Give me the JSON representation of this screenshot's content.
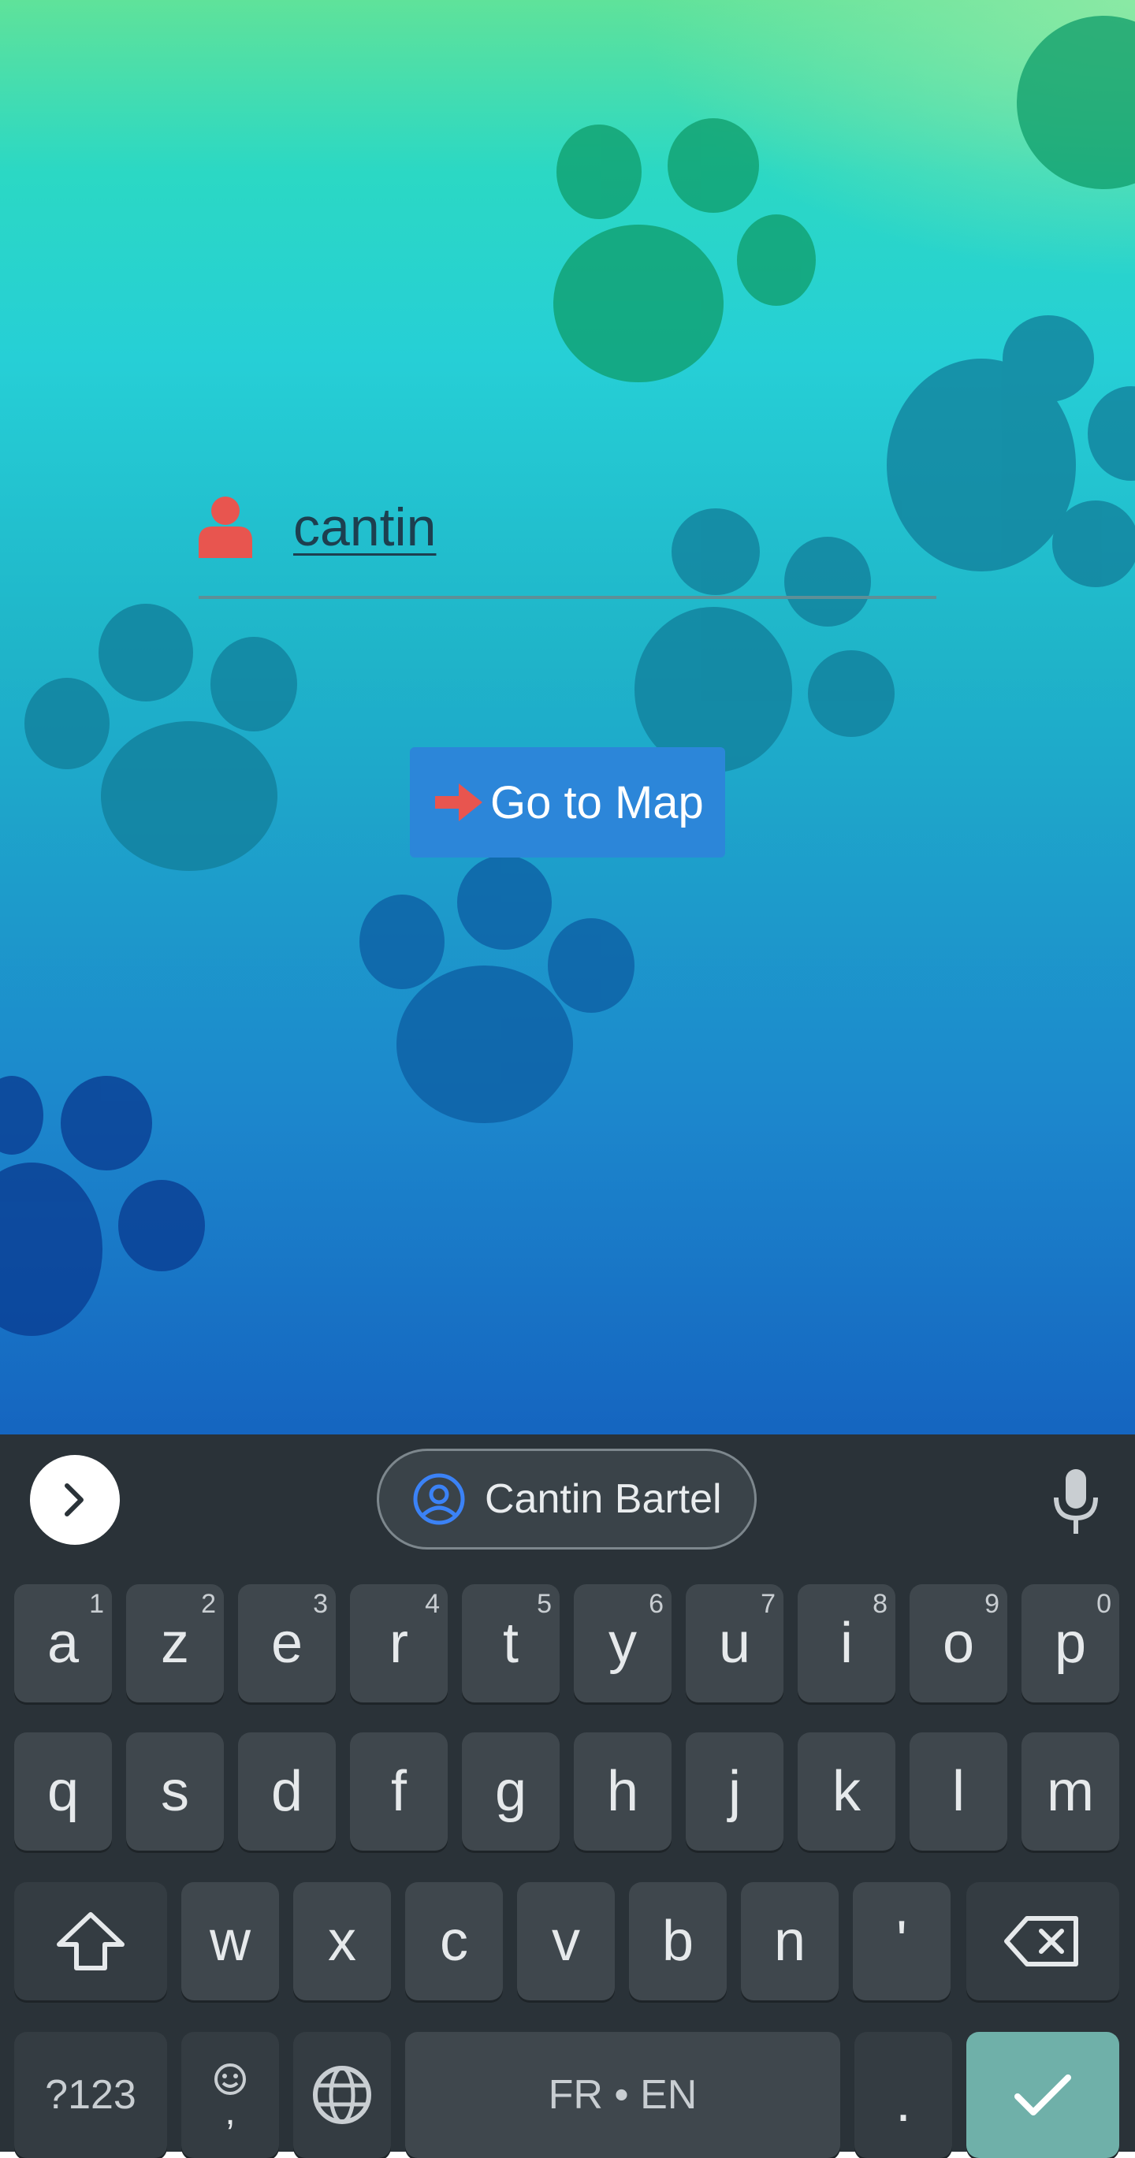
{
  "app": {
    "username": "cantin",
    "go_button_label": "Go to Map"
  },
  "keyboard": {
    "suggestion": "Cantin Bartel",
    "row1": [
      {
        "letter": "a",
        "hint": "1"
      },
      {
        "letter": "z",
        "hint": "2"
      },
      {
        "letter": "e",
        "hint": "3"
      },
      {
        "letter": "r",
        "hint": "4"
      },
      {
        "letter": "t",
        "hint": "5"
      },
      {
        "letter": "y",
        "hint": "6"
      },
      {
        "letter": "u",
        "hint": "7"
      },
      {
        "letter": "i",
        "hint": "8"
      },
      {
        "letter": "o",
        "hint": "9"
      },
      {
        "letter": "p",
        "hint": "0"
      }
    ],
    "row2": [
      "q",
      "s",
      "d",
      "f",
      "g",
      "h",
      "j",
      "k",
      "l",
      "m"
    ],
    "row3": [
      "w",
      "x",
      "c",
      "v",
      "b",
      "n",
      "'"
    ],
    "symbols_label": "?123",
    "comma_label": ",",
    "space_label": "FR • EN",
    "period_label": "."
  },
  "colors": {
    "accent_red": "#e8554f",
    "button_blue": "#2c86d9",
    "enter_key": "#6fb0a9"
  }
}
